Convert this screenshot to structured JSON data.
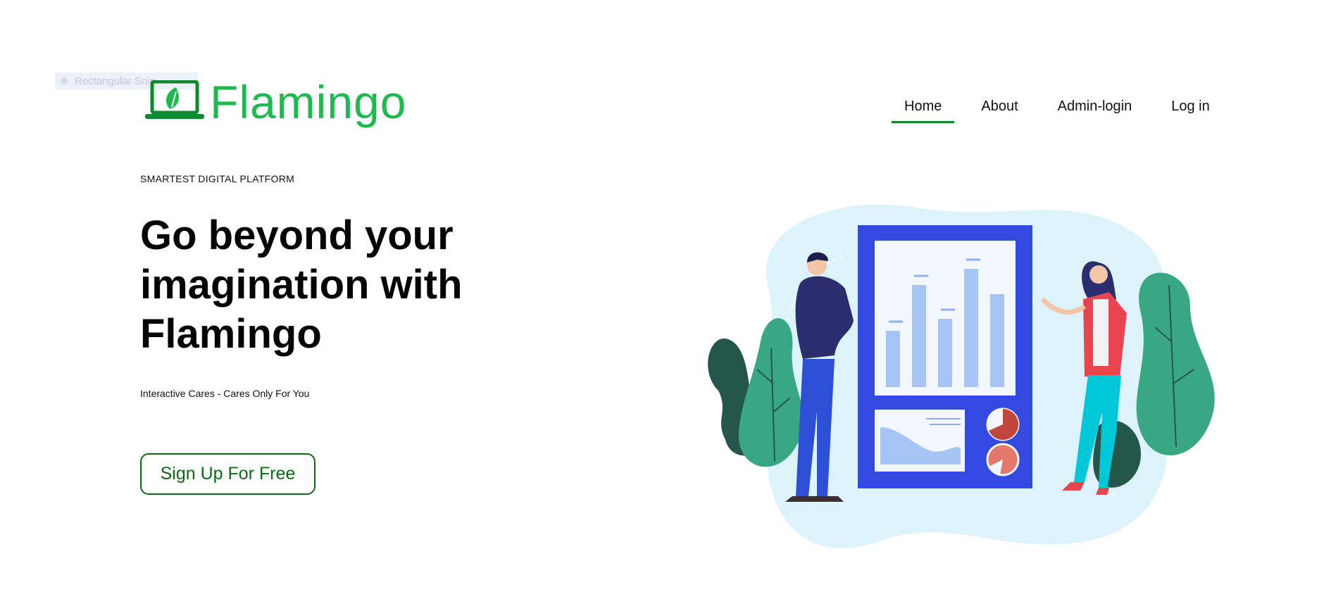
{
  "overlay": {
    "label": "Rectangular Snip"
  },
  "brand": {
    "name": "Flamingo",
    "color": "#20b94f"
  },
  "nav": {
    "items": [
      {
        "label": "Home",
        "active": true
      },
      {
        "label": "About"
      },
      {
        "label": "Admin-login"
      },
      {
        "label": "Log in"
      }
    ],
    "active_color": "#0d8a1e"
  },
  "hero": {
    "eyebrow": "SMARTEST DIGITAL PLATFORM",
    "headline": "Go beyond your imagination with Flamingo",
    "subline": "Interactive Cares - Cares Only For You",
    "cta_label": "Sign Up For Free"
  },
  "illustration": {
    "icon": "people-presenting-dashboard-illustration",
    "board_color": "#3349e0",
    "bar_color": "#a6c4f5",
    "pie_colors": [
      "#c0453a",
      "#e5786a"
    ],
    "leaf_colors": [
      "#3aa784",
      "#24574a"
    ]
  }
}
